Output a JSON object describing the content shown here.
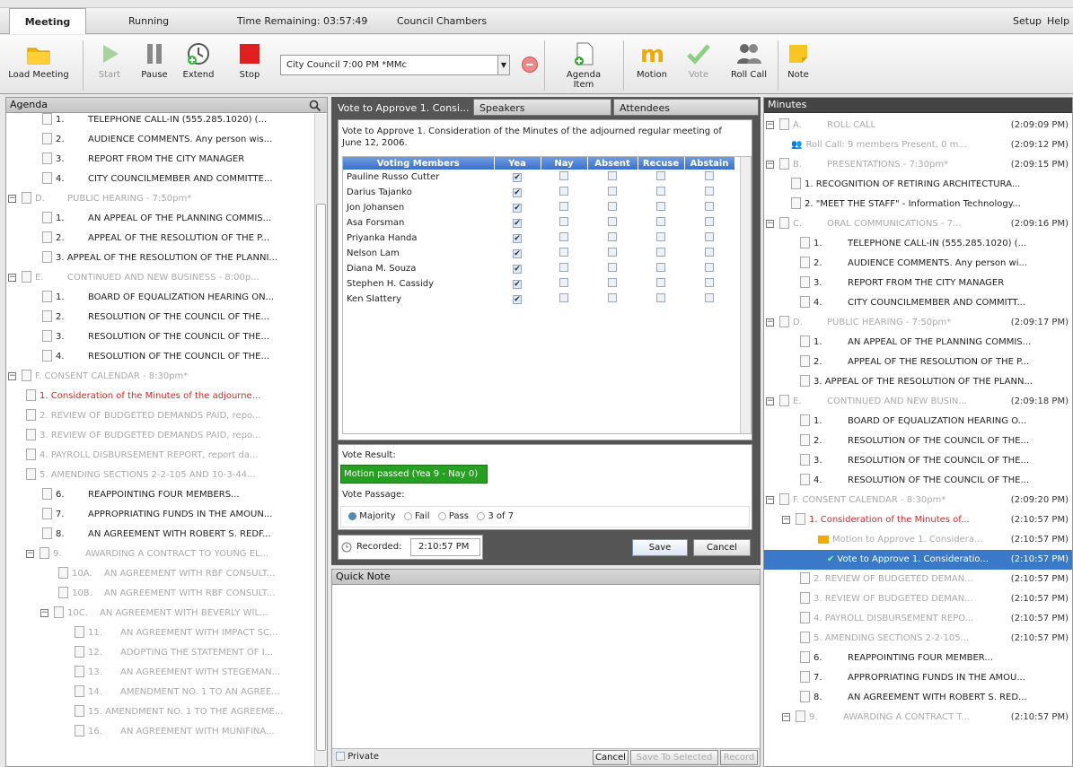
{
  "topbar": {
    "tab_meeting": "Meeting",
    "tab_running": "Running",
    "time_remaining": "Time Remaining: 03:57:49",
    "location": "Council Chambers",
    "setup": "Setup",
    "help": "Help"
  },
  "toolbar": {
    "load_meeting": "Load Meeting",
    "start": "Start",
    "pause": "Pause",
    "extend": "Extend",
    "stop": "Stop",
    "meeting_select": "City Council 7:00 PM *MMc",
    "agenda_item": "Agenda Item",
    "motion": "Motion",
    "vote": "Vote",
    "roll_call": "Roll Call",
    "note": "Note"
  },
  "agenda": {
    "title": "Agenda",
    "items": [
      {
        "label": "1.",
        "text": "TELEPHONE CALL-IN (555.285.1020) (...",
        "style": "normal"
      },
      {
        "label": "2.",
        "text": "AUDIENCE COMMENTS.  Any person wis...",
        "style": "normal"
      },
      {
        "label": "3.",
        "text": "REPORT FROM THE CITY MANAGER",
        "style": "normal"
      },
      {
        "label": "4.",
        "text": "CITY COUNCILMEMBER AND COMMITTE...",
        "style": "normal"
      },
      {
        "label": "D.",
        "text": "PUBLIC HEARING - 7:50pm*",
        "style": "section"
      },
      {
        "label": "1.",
        "text": "AN APPEAL OF THE PLANNING COMMIS...",
        "style": "normal"
      },
      {
        "label": "2.",
        "text": "APPEAL OF THE RESOLUTION OF THE P...",
        "style": "normal"
      },
      {
        "label": "",
        "text": "3. APPEAL OF THE RESOLUTION OF THE PLANNI...",
        "style": "normal"
      },
      {
        "label": "E.",
        "text": "CONTINUED AND NEW BUSINESS - 8:00p...",
        "style": "section"
      },
      {
        "label": "1.",
        "text": "BOARD OF EQUALIZATION HEARING ON...",
        "style": "normal"
      },
      {
        "label": "2.",
        "text": "RESOLUTION OF THE COUNCIL OF THE...",
        "style": "normal"
      },
      {
        "label": "3.",
        "text": "RESOLUTION OF THE COUNCIL OF THE...",
        "style": "normal"
      },
      {
        "label": "4.",
        "text": "RESOLUTION OF THE COUNCIL OF THE...",
        "style": "normal"
      },
      {
        "label": "",
        "text": "F. CONSENT CALENDAR - 8:30pm*",
        "style": "section"
      },
      {
        "label": "",
        "text": "1. Consideration of the Minutes of the adjourne...",
        "style": "red"
      },
      {
        "label": "",
        "text": "2. REVIEW OF BUDGETED DEMANDS PAID, repo...",
        "style": "gray"
      },
      {
        "label": "",
        "text": "3. REVIEW OF BUDGETED DEMANDS PAID, repo...",
        "style": "gray"
      },
      {
        "label": "",
        "text": "4. PAYROLL DISBURSEMENT REPORT, report da...",
        "style": "gray"
      },
      {
        "label": "",
        "text": "5. AMENDING SECTIONS 2-2-105 AND 10-3-44...",
        "style": "gray"
      },
      {
        "label": "6.",
        "text": "REAPPOINTING           FOUR MEMBERS...",
        "style": "normal"
      },
      {
        "label": "7.",
        "text": "APPROPRIATING FUNDS IN THE AMOUN...",
        "style": "normal"
      },
      {
        "label": "8.",
        "text": "AN AGREEMENT WITH ROBERT S. REDF...",
        "style": "normal"
      },
      {
        "label": "9.",
        "text": "AWARDING A CONTRACT TO YOUNG EL...",
        "style": "gray"
      },
      {
        "label": "10A.",
        "text": "AN AGREEMENT WITH RBF CONSULT...",
        "style": "gray"
      },
      {
        "label": "10B.",
        "text": "AN AGREEMENT WITH RBF CONSULT...",
        "style": "gray"
      },
      {
        "label": "10C.",
        "text": "AN AGREEMENT WITH BEVERLY WIL...",
        "style": "gray"
      },
      {
        "label": "11.",
        "text": "AN AGREEMENT WITH IMPACT SC...",
        "style": "gray"
      },
      {
        "label": "12.",
        "text": "ADOPTING THE STATEMENT OF I...",
        "style": "gray"
      },
      {
        "label": "13.",
        "text": "AN AGREEMENT WITH STEGEMAN...",
        "style": "gray"
      },
      {
        "label": "14.",
        "text": "AMENDMENT NO. 1 TO AN AGREE...",
        "style": "gray"
      },
      {
        "label": "",
        "text": "15. AMENDMENT NO. 1 TO THE AGREEME...",
        "style": "gray"
      },
      {
        "label": "16.",
        "text": "AN AGREEMENT WITH MUNIFINA...",
        "style": "gray"
      }
    ]
  },
  "vote_panel": {
    "tabs": [
      "Vote to Approve 1. Consi...",
      "Speakers",
      "Attendees"
    ],
    "description": "Vote to Approve 1. Consideration of the Minutes of the adjourned regular meeting of June 12, 2006.",
    "columns": [
      "Voting Members",
      "Yea",
      "Nay",
      "Absent",
      "Recuse",
      "Abstain"
    ],
    "members": [
      "Pauline Russo Cutter",
      "Darius Tajanko",
      "Jon Johansen",
      "Asa Forsman",
      "Priyanka Handa",
      "Nelson Lam",
      "Diana M. Souza",
      "Stephen H. Cassidy",
      "Ken Slattery"
    ],
    "vote_result_label": "Vote Result:",
    "vote_result": "Motion passed (Yea 9 - Nay 0)",
    "vote_passage_label": "Vote Passage:",
    "passage_options": [
      "Majority",
      "Fail",
      "Pass",
      "3 of 7"
    ],
    "recorded_label": "Recorded:",
    "recorded_time": "2:10:57 PM",
    "save": "Save",
    "cancel": "Cancel"
  },
  "quick_note": {
    "title": "Quick Note",
    "private": "Private",
    "cancel": "Cancel",
    "save_to_selected": "Save To Selected",
    "record": "Record"
  },
  "minutes": {
    "title": "Minutes",
    "items": [
      {
        "label": "A.",
        "text": "ROLL CALL",
        "time": "(2:09:09 PM)",
        "style": "section"
      },
      {
        "label": "",
        "text": "Roll Call: 9 members Present, 0 m...",
        "time": "(2:09:12 PM)",
        "style": "rollcall"
      },
      {
        "label": "B.",
        "text": "PRESENTATIONS - 7:30pm*",
        "time": "(2:09:15 PM)",
        "style": "section"
      },
      {
        "label": "",
        "text": "1. RECOGNITION OF RETIRING ARCHITECTURA...",
        "time": "",
        "style": "normal"
      },
      {
        "label": "",
        "text": "2. \"MEET THE STAFF\" - Information Technology...",
        "time": "",
        "style": "normal"
      },
      {
        "label": "C.",
        "text": "ORAL COMMUNICATIONS - 7...",
        "time": "(2:09:16 PM)",
        "style": "section"
      },
      {
        "label": "1.",
        "text": "TELEPHONE CALL-IN (555.285.1020) (...",
        "time": "",
        "style": "normal"
      },
      {
        "label": "2.",
        "text": "AUDIENCE COMMENTS.  Any person wi...",
        "time": "",
        "style": "normal"
      },
      {
        "label": "3.",
        "text": "REPORT FROM THE CITY MANAGER",
        "time": "",
        "style": "normal"
      },
      {
        "label": "4.",
        "text": "CITY COUNCILMEMBER AND COMMITT...",
        "time": "",
        "style": "normal"
      },
      {
        "label": "D.",
        "text": "PUBLIC HEARING - 7:50pm*",
        "time": "(2:09:17 PM)",
        "style": "section"
      },
      {
        "label": "1.",
        "text": "AN APPEAL OF THE PLANNING COMMIS...",
        "time": "",
        "style": "normal"
      },
      {
        "label": "2.",
        "text": "APPEAL OF THE RESOLUTION OF THE P...",
        "time": "",
        "style": "normal"
      },
      {
        "label": "",
        "text": "3. APPEAL OF THE RESOLUTION OF THE PLANN...",
        "time": "",
        "style": "normal"
      },
      {
        "label": "E.",
        "text": "CONTINUED AND NEW BUSIN...",
        "time": "(2:09:18 PM)",
        "style": "section"
      },
      {
        "label": "1.",
        "text": "BOARD OF EQUALIZATION HEARING O...",
        "time": "",
        "style": "normal"
      },
      {
        "label": "2.",
        "text": "RESOLUTION OF THE COUNCIL OF THE...",
        "time": "",
        "style": "normal"
      },
      {
        "label": "3.",
        "text": "RESOLUTION OF THE COUNCIL OF THE...",
        "time": "",
        "style": "normal"
      },
      {
        "label": "4.",
        "text": "RESOLUTION OF THE COUNCIL OF THE...",
        "time": "",
        "style": "normal"
      },
      {
        "label": "",
        "text": "F. CONSENT CALENDAR - 8:30pm*",
        "time": "(2:09:20 PM)",
        "style": "section"
      },
      {
        "label": "",
        "text": "1. Consideration of the Minutes of...",
        "time": "(2:10:57 PM)",
        "style": "red"
      },
      {
        "label": "",
        "text": "Motion to Approve 1. Considera...",
        "time": "(2:10:57 PM)",
        "style": "motion"
      },
      {
        "label": "",
        "text": "Vote to Approve 1. Consideratio...",
        "time": "(2:10:57 PM)",
        "style": "selected"
      },
      {
        "label": "",
        "text": "2. REVIEW OF BUDGETED DEMAN...",
        "time": "(2:10:57 PM)",
        "style": "gray"
      },
      {
        "label": "",
        "text": "3. REVIEW OF BUDGETED DEMAN...",
        "time": "(2:10:57 PM)",
        "style": "gray"
      },
      {
        "label": "",
        "text": "4. PAYROLL DISBURSEMENT REPO...",
        "time": "(2:10:57 PM)",
        "style": "gray"
      },
      {
        "label": "",
        "text": "5. AMENDING SECTIONS 2-2-105...",
        "time": "(2:10:57 PM)",
        "style": "gray"
      },
      {
        "label": "6.",
        "text": "REAPPOINTING             FOUR MEMBER...",
        "time": "",
        "style": "normal"
      },
      {
        "label": "7.",
        "text": "APPROPRIATING FUNDS IN THE AMOU...",
        "time": "",
        "style": "normal"
      },
      {
        "label": "8.",
        "text": "AN AGREEMENT WITH ROBERT S. RED...",
        "time": "",
        "style": "normal"
      },
      {
        "label": "9.",
        "text": "AWARDING A CONTRACT T...",
        "time": "(2:10:57 PM)",
        "style": "gray"
      }
    ]
  }
}
